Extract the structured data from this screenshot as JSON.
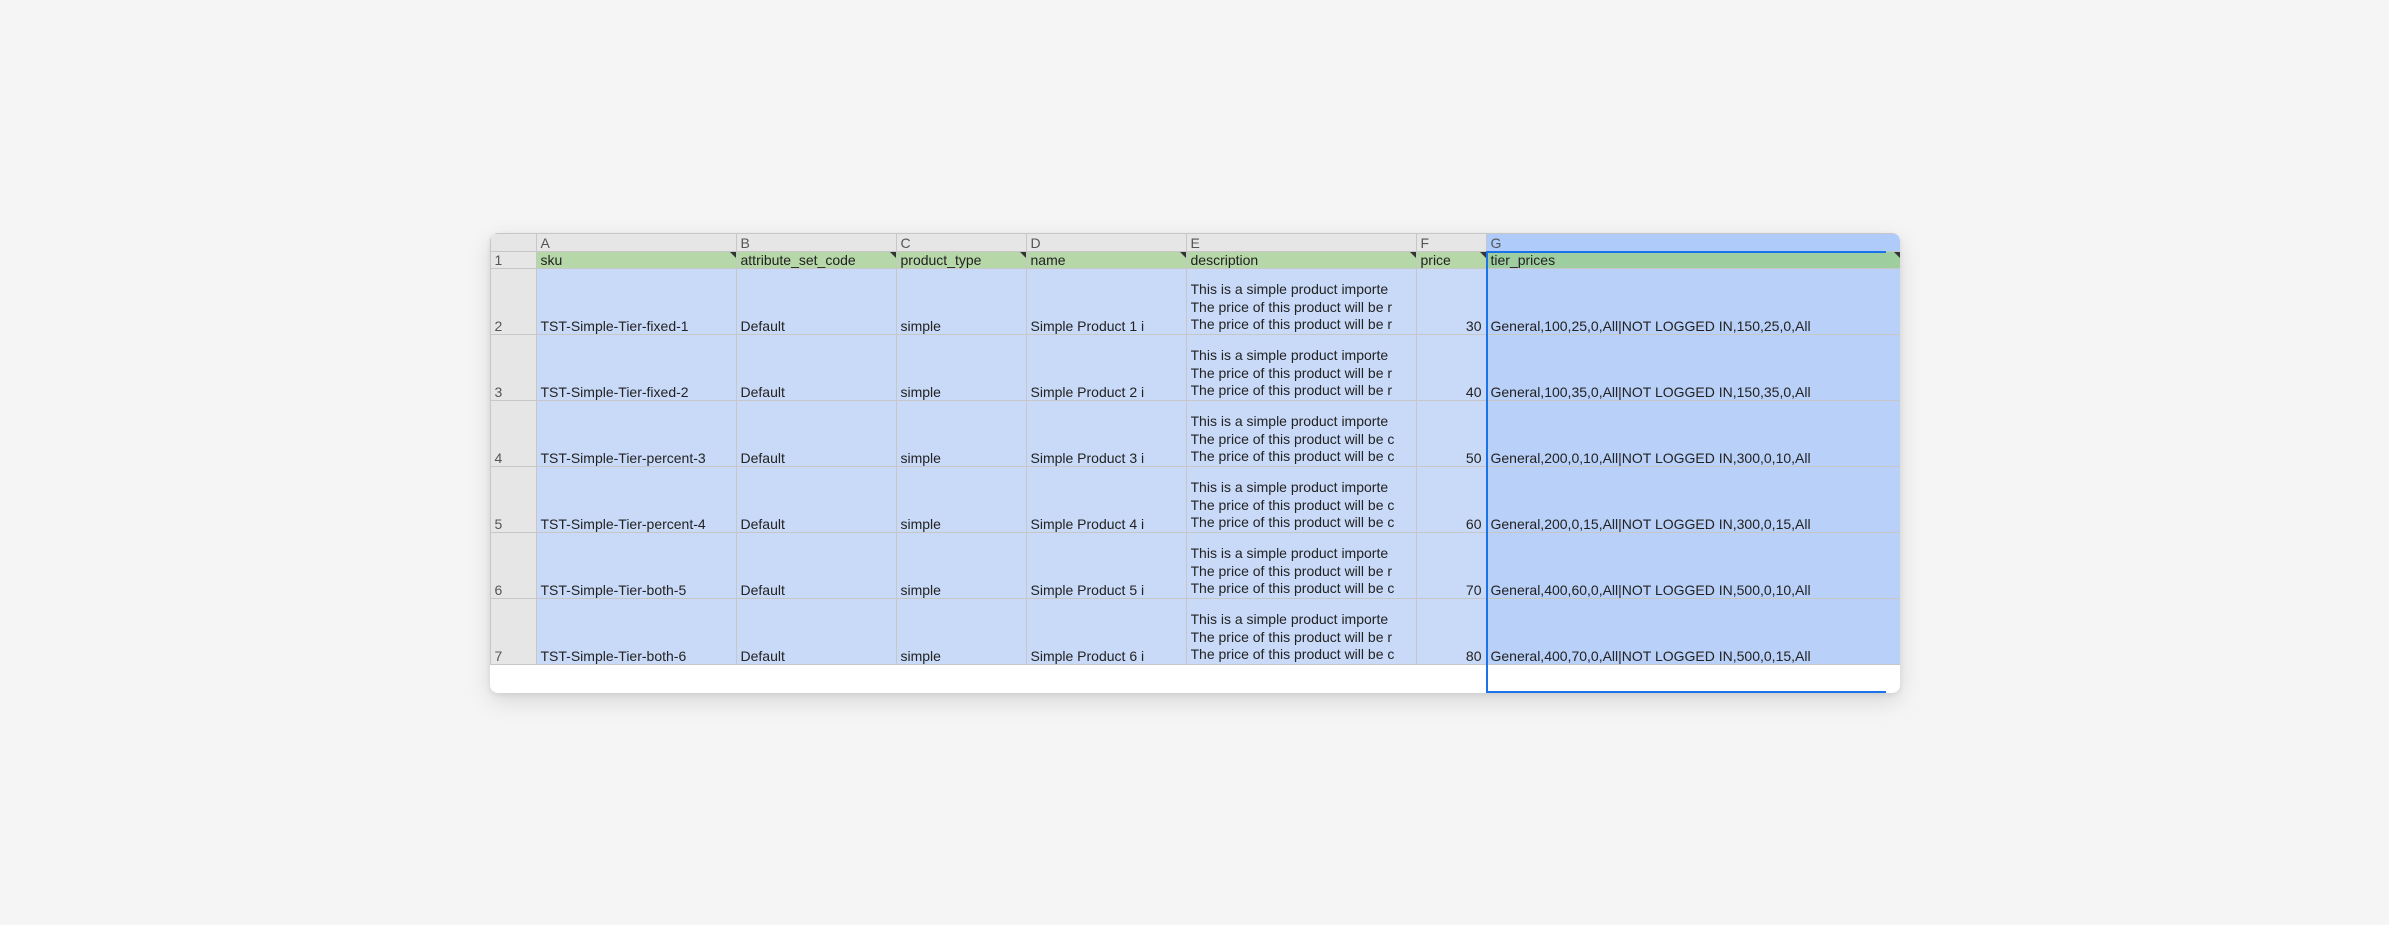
{
  "columns": [
    "A",
    "B",
    "C",
    "D",
    "E",
    "F",
    "G"
  ],
  "selected_column": "G",
  "headers": {
    "A": "sku",
    "B": "attribute_set_code",
    "C": "product_type",
    "D": "name",
    "E": "description",
    "F": "price",
    "G": "tier_prices"
  },
  "header_notes": [
    "A",
    "B",
    "C",
    "D",
    "E",
    "F",
    "G"
  ],
  "rows": [
    {
      "sku": "TST-Simple-Tier-fixed-1",
      "attribute_set_code": "Default",
      "product_type": "simple",
      "name": "Simple Product 1 i",
      "description_lines": [
        "This is a simple product importe",
        "The price of this product will be r",
        "The price of this product will be r"
      ],
      "price": "30",
      "tier_prices": "General,100,25,0,All|NOT LOGGED IN,150,25,0,All"
    },
    {
      "sku": "TST-Simple-Tier-fixed-2",
      "attribute_set_code": "Default",
      "product_type": "simple",
      "name": "Simple Product 2 i",
      "description_lines": [
        "This is a simple product importe",
        "The price of this product will be r",
        "The price of this product will be r"
      ],
      "price": "40",
      "tier_prices": "General,100,35,0,All|NOT LOGGED IN,150,35,0,All"
    },
    {
      "sku": "TST-Simple-Tier-percent-3",
      "attribute_set_code": "Default",
      "product_type": "simple",
      "name": "Simple Product 3 i",
      "description_lines": [
        "This is a simple product importe",
        "The price of this product will be c",
        "The price of this product will be c"
      ],
      "price": "50",
      "tier_prices": "General,200,0,10,All|NOT LOGGED IN,300,0,10,All"
    },
    {
      "sku": "TST-Simple-Tier-percent-4",
      "attribute_set_code": "Default",
      "product_type": "simple",
      "name": "Simple Product 4 i",
      "description_lines": [
        "This is a simple product importe",
        "The price of this product will be c",
        "The price of this product will be c"
      ],
      "price": "60",
      "tier_prices": "General,200,0,15,All|NOT LOGGED IN,300,0,15,All"
    },
    {
      "sku": "TST-Simple-Tier-both-5",
      "attribute_set_code": "Default",
      "product_type": "simple",
      "name": "Simple Product 5 i",
      "description_lines": [
        "This is a simple product importe",
        "The price of this product will be r",
        "The price of this product will be c"
      ],
      "price": "70",
      "tier_prices": "General,400,60,0,All|NOT LOGGED IN,500,0,10,All"
    },
    {
      "sku": "TST-Simple-Tier-both-6",
      "attribute_set_code": "Default",
      "product_type": "simple",
      "name": "Simple Product 6 i",
      "description_lines": [
        "This is a simple product importe",
        "The price of this product will be r",
        "The price of this product will be c"
      ],
      "price": "80",
      "tier_prices": "General,400,70,0,All|NOT LOGGED IN,500,0,15,All"
    }
  ]
}
